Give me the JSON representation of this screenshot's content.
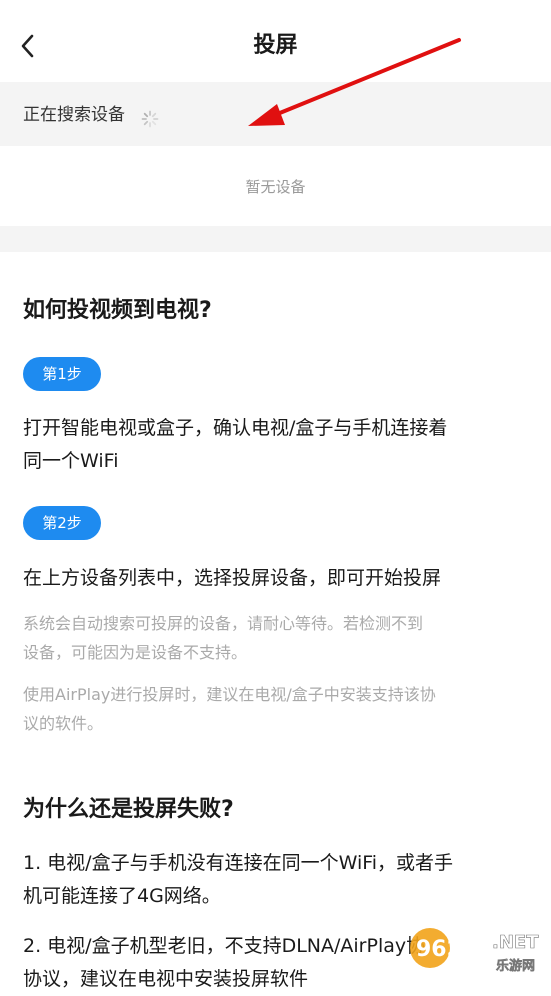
{
  "header": {
    "title": "投屏",
    "back_icon": "chevron-left-icon"
  },
  "search": {
    "status": "正在搜索设备",
    "spinner_icon": "loading-spinner-icon"
  },
  "devices": {
    "empty_text": "暂无设备"
  },
  "guide": {
    "title": "如何投视频到电视?",
    "steps": [
      {
        "badge": "第1步",
        "text_lines": [
          "打开智能电视或盒子，确认电视/盒子与手机连接着",
          "同一个WiFi"
        ]
      },
      {
        "badge": "第2步",
        "text_lines": [
          "在上方设备列表中，选择投屏设备，即可开始投屏"
        ],
        "hints": [
          {
            "lines": [
              "系统会自动搜索可投屏的设备，请耐心等待。若检测不到",
              "设备，可能因为是设备不支持。"
            ]
          },
          {
            "lines": [
              "使用AirPlay进行投屏时，建议在电视/盒子中安装支持该协",
              "议的软件。"
            ]
          }
        ]
      }
    ]
  },
  "faq": {
    "title": "为什么还是投屏失败?",
    "items": [
      {
        "lines": [
          "1. 电视/盒子与手机没有连接在同一个WiFi，或者手",
          "机可能连接了4G网络。"
        ]
      },
      {
        "lines": [
          "2. 电视/盒子机型老旧，不支持DLNA/AirPlay协",
          "协议，建议在电视中安装投屏软件"
        ]
      }
    ]
  },
  "annotation": {
    "arrow_color": "#e01010"
  },
  "watermark": {
    "text": "962",
    "sub": ".NET",
    "caption": "乐游网"
  },
  "colors": {
    "accent": "#1e8bf0",
    "band": "#f4f4f4",
    "hint": "#aaaaaa"
  }
}
